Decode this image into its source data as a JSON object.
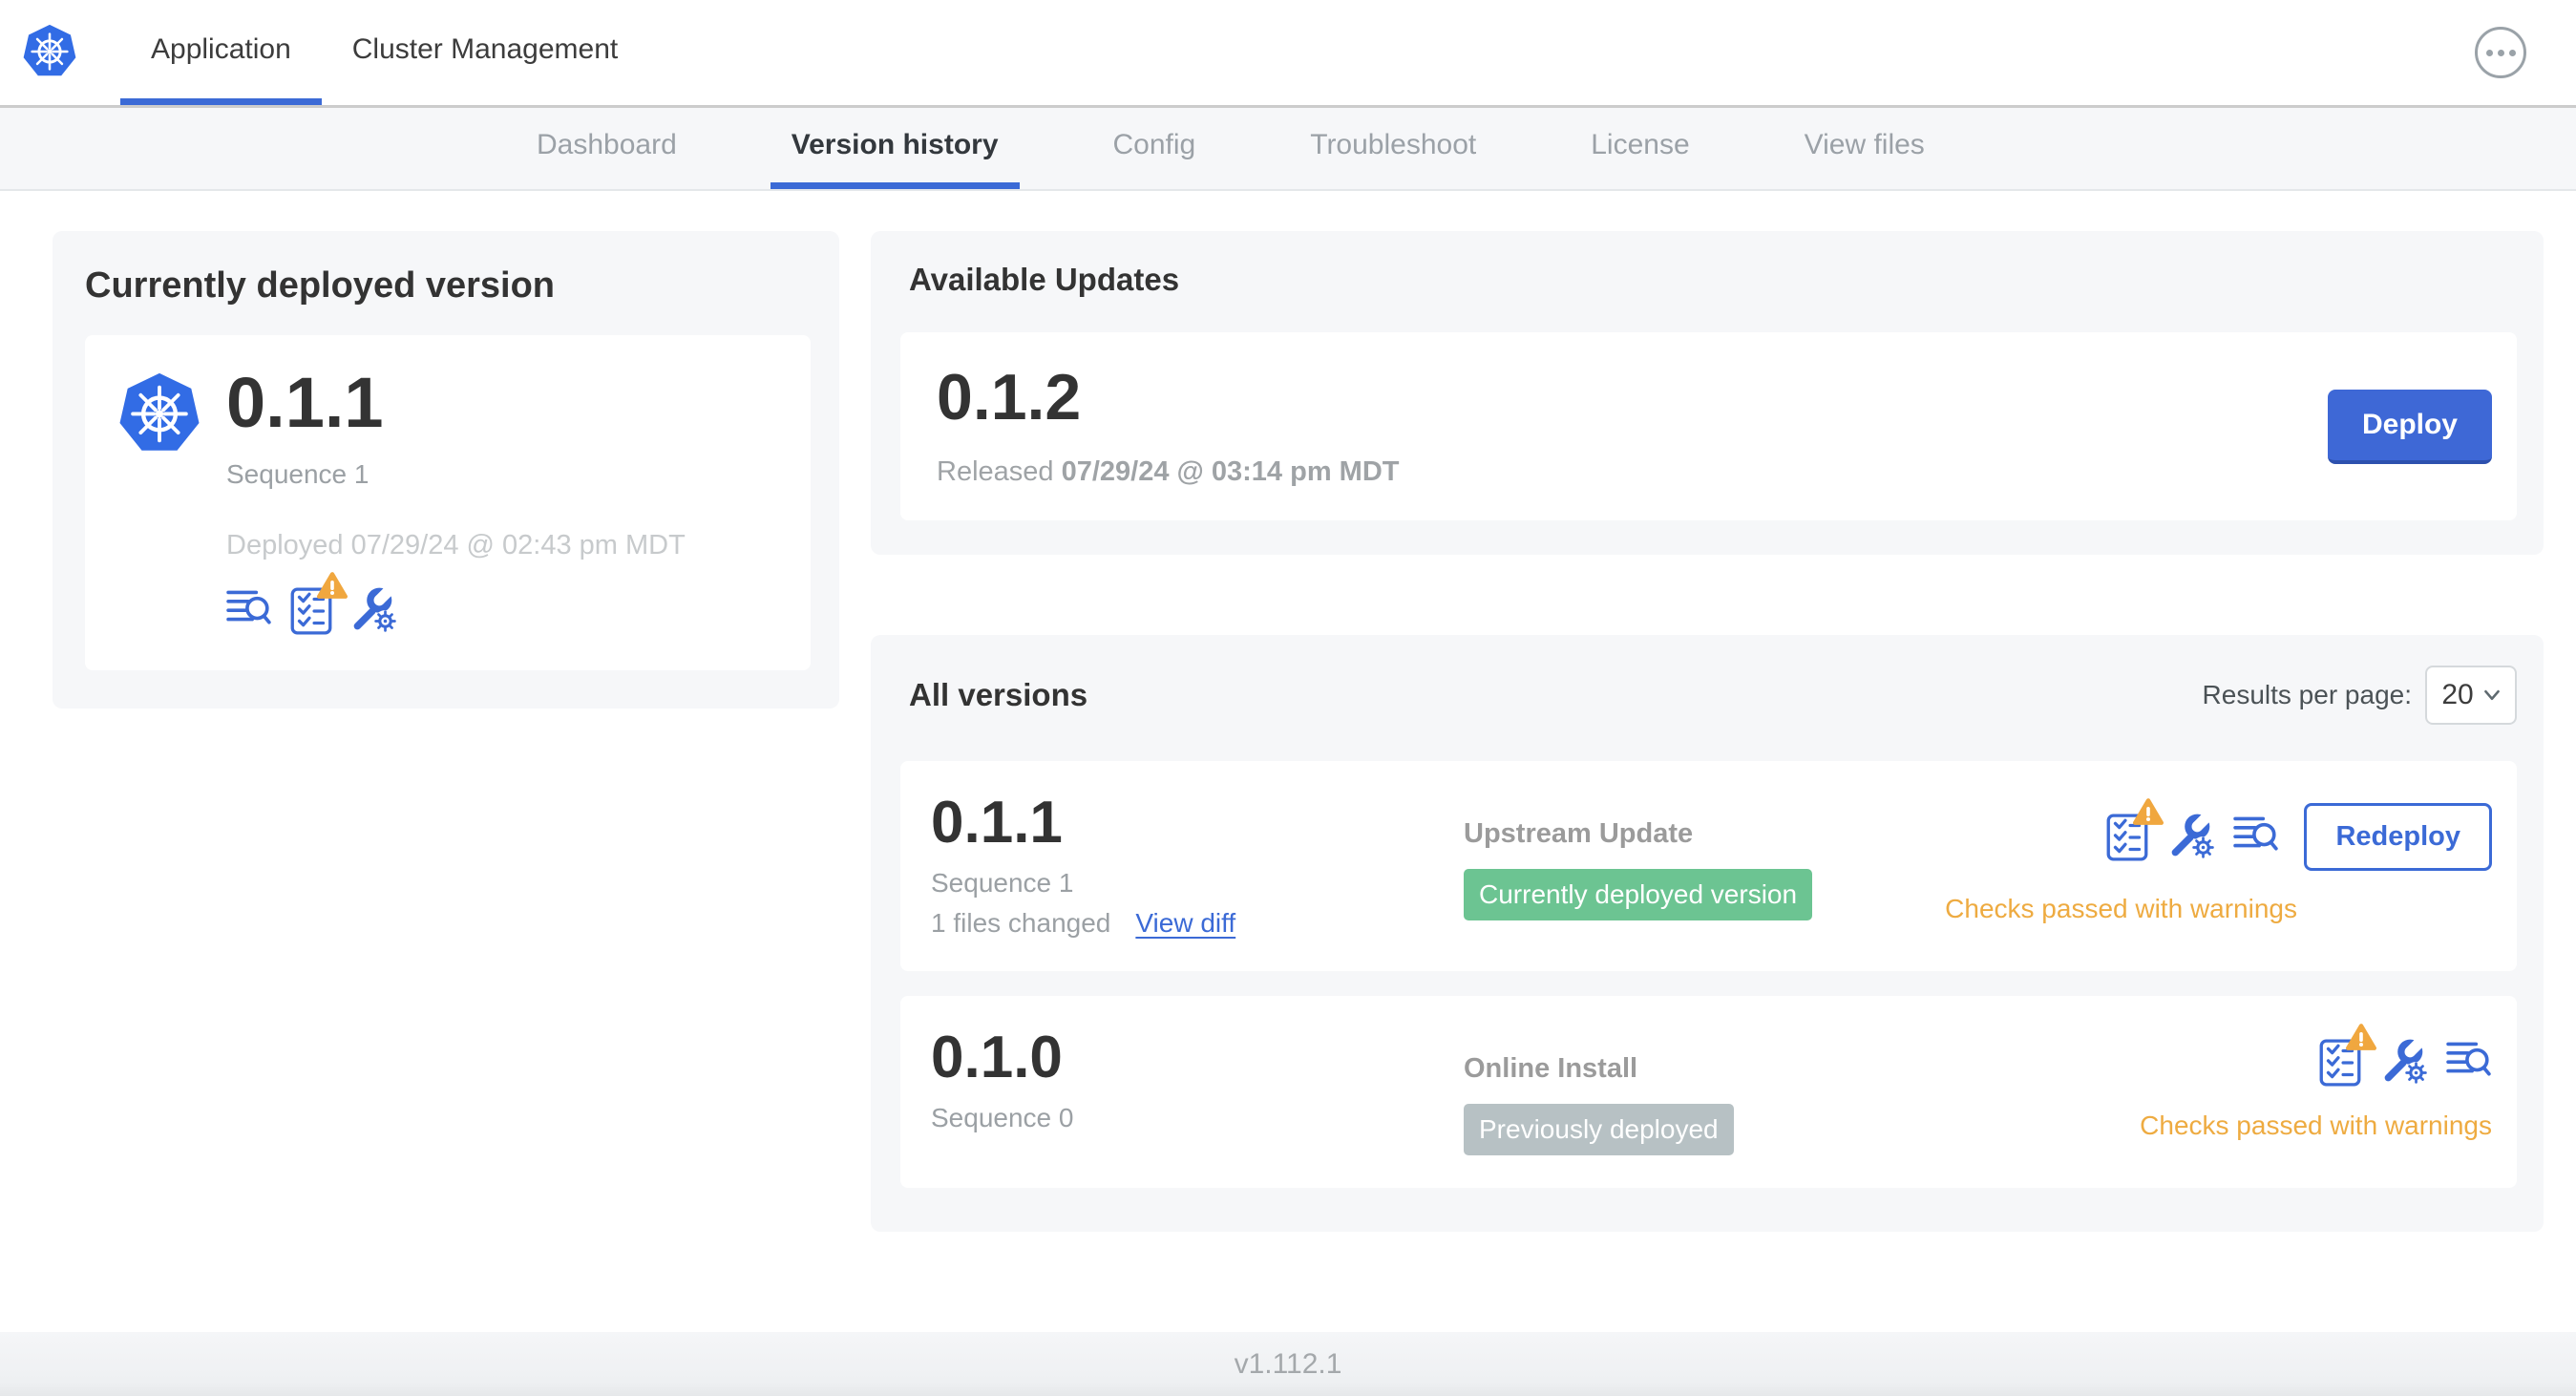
{
  "topbar": {
    "tabs": [
      {
        "label": "Application",
        "active": true
      },
      {
        "label": "Cluster Management",
        "active": false
      }
    ],
    "more_icon": "ellipsis-menu"
  },
  "subnav": {
    "items": [
      {
        "label": "Dashboard",
        "active": false
      },
      {
        "label": "Version history",
        "active": true
      },
      {
        "label": "Config",
        "active": false
      },
      {
        "label": "Troubleshoot",
        "active": false
      },
      {
        "label": "License",
        "active": false
      },
      {
        "label": "View files",
        "active": false
      }
    ]
  },
  "current_version": {
    "title": "Currently deployed version",
    "version": "0.1.1",
    "sequence": "Sequence 1",
    "deployed": "Deployed 07/29/24 @ 02:43 pm MDT",
    "icons": [
      "logs-icon",
      "preflight-checks-warning-icon",
      "config-icon"
    ]
  },
  "available_updates": {
    "title": "Available Updates",
    "version": "0.1.2",
    "released_prefix": "Released",
    "released_date": "07/29/24 @ 03:14 pm MDT",
    "deploy_label": "Deploy"
  },
  "all_versions": {
    "title": "All versions",
    "results_per_page_label": "Results per page:",
    "results_per_page_value": "20",
    "rows": [
      {
        "version": "0.1.1",
        "sequence": "Sequence 1",
        "files_changed": "1 files changed",
        "view_diff_label": "View diff",
        "source": "Upstream Update",
        "badge": "Currently deployed version",
        "badge_color": "#6cc492",
        "status": "Checks passed with warnings",
        "action_label": "Redeploy",
        "icons": [
          "preflight-checks-warning-icon",
          "config-icon",
          "logs-icon"
        ]
      },
      {
        "version": "0.1.0",
        "sequence": "Sequence 0",
        "source": "Online Install",
        "badge": "Previously deployed",
        "badge_color": "#b7c1c4",
        "status": "Checks passed with warnings",
        "icons": [
          "preflight-checks-warning-icon",
          "config-icon",
          "logs-icon"
        ]
      }
    ]
  },
  "footer": {
    "app_version": "v1.112.1"
  },
  "colors": {
    "accent_blue": "#3b6ad6",
    "logo_blue": "#326ce5",
    "badge_green": "#6cc492",
    "badge_gray": "#b7c1c4",
    "warning_orange": "#eeab41",
    "heading_text": "#333333",
    "muted_text": "#9ba0a4",
    "faint_text": "#c7cacc",
    "card_bg": "#f6f7f9"
  }
}
